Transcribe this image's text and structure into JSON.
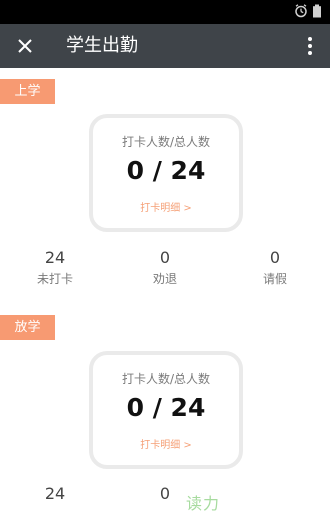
{
  "app_bar": {
    "title": "学生出勤"
  },
  "colors": {
    "status_bar": "#000000",
    "app_bar": "#3f4449",
    "accent": "#f79a72",
    "card_border": "#eaeaea"
  },
  "sections": [
    {
      "tag": "上学",
      "card": {
        "label": "打卡人数/总人数",
        "value": "0 / 24",
        "link": "打卡明细 >"
      },
      "stats": [
        {
          "value": "24",
          "label": "未打卡"
        },
        {
          "value": "0",
          "label": "劝退"
        },
        {
          "value": "0",
          "label": "请假"
        }
      ]
    },
    {
      "tag": "放学",
      "card": {
        "label": "打卡人数/总人数",
        "value": "0 / 24",
        "link": "打卡明细 >"
      },
      "stats": [
        {
          "value": "24",
          "label": ""
        },
        {
          "value": "0",
          "label": ""
        }
      ]
    }
  ],
  "watermark": "读力"
}
